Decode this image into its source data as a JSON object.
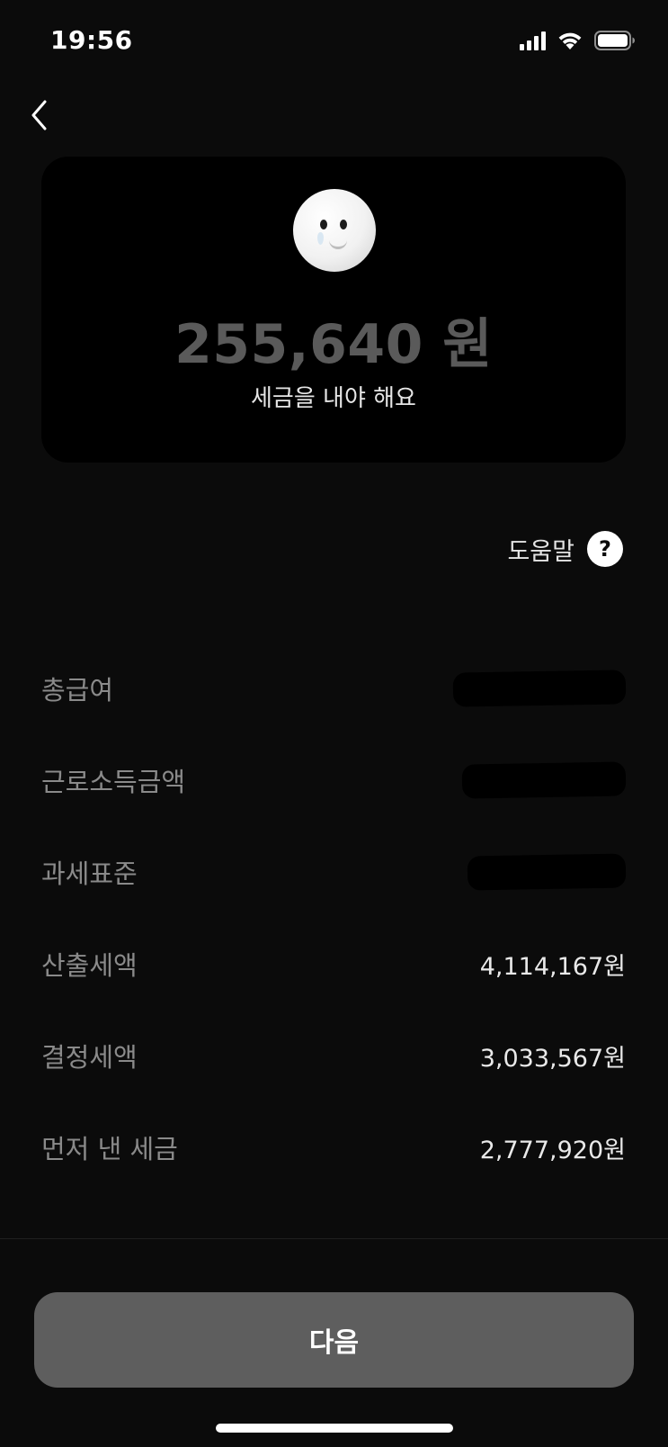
{
  "status_bar": {
    "time": "19:56",
    "icons": [
      "signal-icon",
      "wifi-icon",
      "battery-icon"
    ]
  },
  "nav": {
    "back_icon": "chevron-left-icon"
  },
  "summary": {
    "icon": "face-icon",
    "amount": "255,640 원",
    "subtitle": "세금을 내야 해요"
  },
  "help": {
    "label": "도움말",
    "icon_glyph": "?"
  },
  "rows": [
    {
      "label": "총급여",
      "value": null,
      "redacted": true
    },
    {
      "label": "근로소득금액",
      "value": null,
      "redacted": true
    },
    {
      "label": "과세표준",
      "value": null,
      "redacted": true
    },
    {
      "label": "산출세액",
      "value": "4,114,167원",
      "redacted": false
    },
    {
      "label": "결정세액",
      "value": "3,033,567원",
      "redacted": false
    },
    {
      "label": "먼저 낸 세금",
      "value": "2,777,920원",
      "redacted": false
    }
  ],
  "footer": {
    "next_label": "다음"
  },
  "colors": {
    "background": "#0b0b0b",
    "card": "#000000",
    "button": "#5e5e5e",
    "amount_text": "#5a5a5a"
  }
}
